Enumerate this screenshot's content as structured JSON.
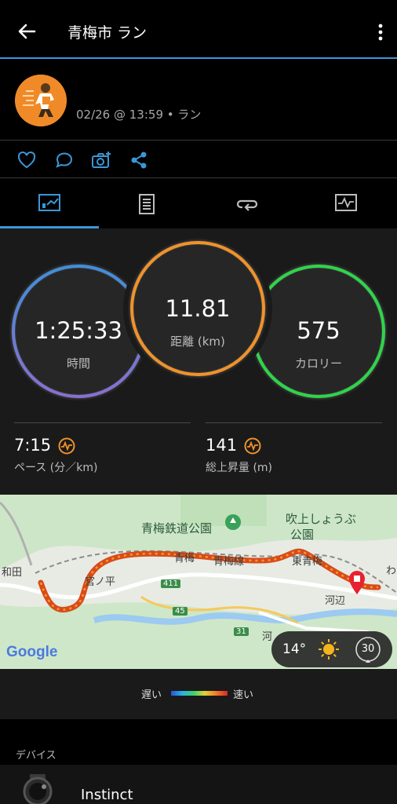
{
  "header": {
    "title": "青梅市 ラン",
    "back_icon": "back-arrow-icon",
    "more_icon": "more-vert-icon"
  },
  "activity": {
    "meta": "02/26 @ 13:59 • ラン"
  },
  "social": [
    "heart-icon",
    "comment-icon",
    "add-photo-icon",
    "share-icon"
  ],
  "tabs": [
    {
      "icon": "summary-chart-icon",
      "selected": true
    },
    {
      "icon": "details-list-icon",
      "selected": false
    },
    {
      "icon": "laps-icon",
      "selected": false
    },
    {
      "icon": "graph-icon",
      "selected": false
    }
  ],
  "stats": {
    "time": {
      "value": "1:25:33",
      "label": "時間"
    },
    "distance": {
      "value": "11.81",
      "label": "距離 (km)"
    },
    "calories": {
      "value": "575",
      "label": "カロリー"
    },
    "pace": {
      "value": "7:15",
      "label": "ペース (分／km)"
    },
    "elevation": {
      "value": "141",
      "label": "総上昇量 (m)"
    }
  },
  "map": {
    "labels": [
      "青梅鉄道公園",
      "吹上しょうぶ",
      "公園",
      "青梅",
      "青梅線",
      "東青梅",
      "宮ノ平",
      "河辺",
      "和田",
      "わ",
      "河"
    ],
    "road_numbers": [
      "411",
      "45",
      "31"
    ],
    "attribution": "Google",
    "weather": {
      "temp": "14°",
      "icon": "sun-icon",
      "wind": "30"
    }
  },
  "legend": {
    "slow": "遅い",
    "fast": "速い"
  },
  "devices": {
    "header": "デバイス",
    "name": "Instinct"
  },
  "colors": {
    "accent": "#3b97d6",
    "time_ring": "#5a7fd8",
    "distance_ring": "#f0922a",
    "calorie_ring": "#2fd44a",
    "orange": "#f08a28"
  }
}
